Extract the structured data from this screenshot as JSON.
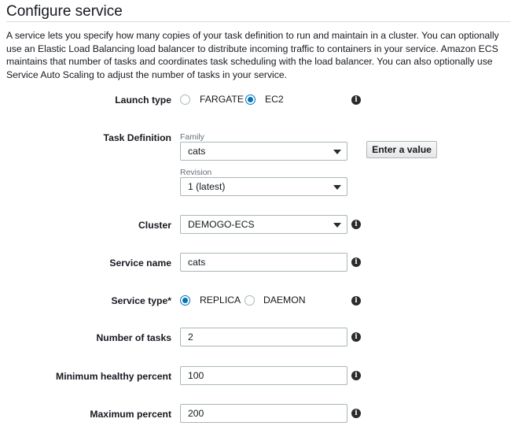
{
  "header": {
    "title": "Configure service",
    "description": "A service lets you specify how many copies of your task definition to run and maintain in a cluster. You can optionally use an Elastic Load Balancing load balancer to distribute incoming traffic to containers in your service. Amazon ECS maintains that number of tasks and coordinates task scheduling with the load balancer. You can also optionally use Service Auto Scaling to adjust the number of tasks in your service."
  },
  "launch_type": {
    "label": "Launch type",
    "options": [
      "FARGATE",
      "EC2"
    ],
    "selected": "EC2"
  },
  "task_definition": {
    "label": "Task Definition",
    "family_label": "Family",
    "family_value": "cats",
    "revision_label": "Revision",
    "revision_value": "1 (latest)",
    "enter_value_button": "Enter a value"
  },
  "cluster": {
    "label": "Cluster",
    "value": "DEMOGO-ECS"
  },
  "service_name": {
    "label": "Service name",
    "value": "cats"
  },
  "service_type": {
    "label": "Service type*",
    "options": [
      "REPLICA",
      "DAEMON"
    ],
    "selected": "REPLICA"
  },
  "number_of_tasks": {
    "label": "Number of tasks",
    "value": "2"
  },
  "min_healthy_percent": {
    "label": "Minimum healthy percent",
    "value": "100"
  },
  "max_percent": {
    "label": "Maximum percent",
    "value": "200"
  },
  "icons": {
    "info": "info-icon",
    "dropdown": "chevron-down-icon"
  },
  "colors": {
    "accent": "#0073bb",
    "border": "#aab7b8"
  }
}
